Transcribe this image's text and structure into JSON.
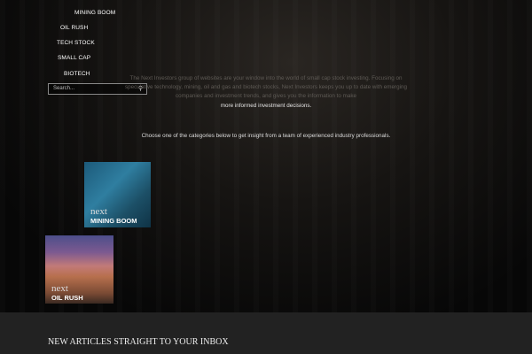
{
  "nav": {
    "items": [
      "MINING BOOM",
      "OIL RUSH",
      "TECH STOCK",
      "SMALL CAP",
      "BIOTECH"
    ]
  },
  "search": {
    "placeholder": "Search...",
    "icon": "search-icon"
  },
  "intro": {
    "text": "The Next Investors group of websites are your window into the world of small cap stock investing. Focusing on speculative technology, mining, oil and gas and biotech stocks, Next Investors keeps you up to date with emerging companies and investment trends, and gives you the information to make",
    "highlight": "more informed investment decisions."
  },
  "choose": "Choose one of the categories below to get insight from a team of experienced industry professionals.",
  "tiles": [
    {
      "brand": "next",
      "title": "MINING BOOM"
    },
    {
      "brand": "next",
      "title": "OIL RUSH"
    }
  ],
  "footer": {
    "heading": "NEW ARTICLES STRAIGHT TO YOUR INBOX"
  }
}
